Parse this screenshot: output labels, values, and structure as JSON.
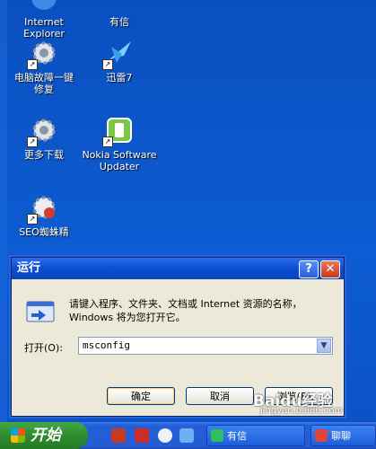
{
  "desktop": {
    "icons": [
      {
        "label": "Internet\nExplorer"
      },
      {
        "label": "有信"
      },
      {
        "label": "电脑故障一键\n修复"
      },
      {
        "label": "迅雷7"
      },
      {
        "label": "更多下载"
      },
      {
        "label": "Nokia Software\nUpdater"
      },
      {
        "label": "SEO蜘蛛精"
      }
    ]
  },
  "run_dialog": {
    "title": "运行",
    "description": "请键入程序、文件夹、文档或 Internet 资源的名称，Windows 将为您打开它。",
    "open_label": "打开(O):",
    "input_value": "msconfig",
    "buttons": {
      "ok": "确定",
      "cancel": "取消",
      "browse": "浏览(B)..."
    }
  },
  "taskbar": {
    "start_label": "开始",
    "tasks": [
      {
        "label": "有信"
      },
      {
        "label": "聊聊"
      }
    ]
  },
  "watermark": {
    "text": "Baidu经验",
    "url": "jingyan.baidu.com"
  },
  "colors": {
    "desktop": "#0d5cd3",
    "dialog": "#ece9d8",
    "titlebar": "#0a4fd0",
    "start": "#2e8b2e"
  }
}
